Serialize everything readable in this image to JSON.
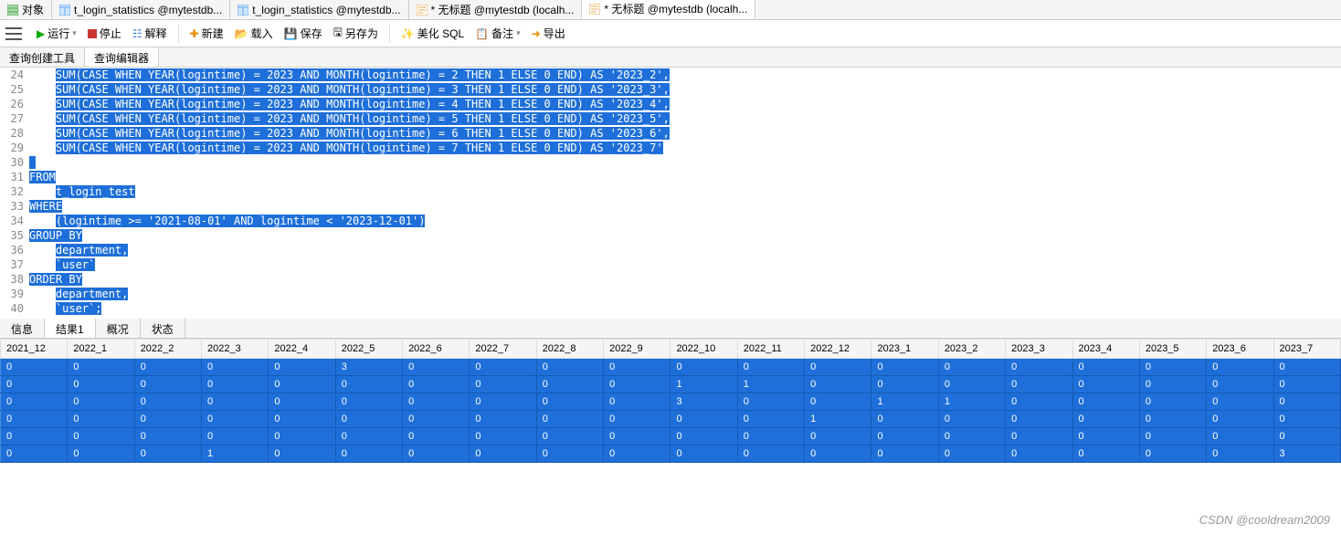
{
  "tabs": [
    {
      "label": "对象"
    },
    {
      "label": "t_login_statistics @mytestdb..."
    },
    {
      "label": "t_login_statistics @mytestdb..."
    },
    {
      "label": "* 无标题 @mytestdb (localh..."
    },
    {
      "label": "* 无标题 @mytestdb (localh..."
    }
  ],
  "toolbar": {
    "run": "运行",
    "stop": "停止",
    "explain": "解释",
    "new": "新建",
    "load": "载入",
    "save": "保存",
    "saveas": "另存为",
    "beautify": "美化 SQL",
    "comment": "备注",
    "export": "导出"
  },
  "secondaryTabs": [
    "查询创建工具",
    "查询编辑器"
  ],
  "code": {
    "startLine": 24,
    "lines": [
      "    SUM(CASE WHEN YEAR(logintime) = 2023 AND MONTH(logintime) = 2 THEN 1 ELSE 0 END) AS '2023_2',",
      "    SUM(CASE WHEN YEAR(logintime) = 2023 AND MONTH(logintime) = 3 THEN 1 ELSE 0 END) AS '2023_3',",
      "    SUM(CASE WHEN YEAR(logintime) = 2023 AND MONTH(logintime) = 4 THEN 1 ELSE 0 END) AS '2023_4',",
      "    SUM(CASE WHEN YEAR(logintime) = 2023 AND MONTH(logintime) = 5 THEN 1 ELSE 0 END) AS '2023_5',",
      "    SUM(CASE WHEN YEAR(logintime) = 2023 AND MONTH(logintime) = 6 THEN 1 ELSE 0 END) AS '2023_6',",
      "    SUM(CASE WHEN YEAR(logintime) = 2023 AND MONTH(logintime) = 7 THEN 1 ELSE 0 END) AS '2023_7'",
      "",
      "FROM",
      "    t_login_test",
      "WHERE",
      "    (logintime >= '2021-08-01' AND logintime < '2023-12-01')",
      "GROUP BY",
      "    department,",
      "    `user`",
      "ORDER BY",
      "    department,",
      "    `user`;"
    ]
  },
  "resultTabs": [
    "信息",
    "结果1",
    "概况",
    "状态"
  ],
  "grid": {
    "columns": [
      "2021_12",
      "2022_1",
      "2022_2",
      "2022_3",
      "2022_4",
      "2022_5",
      "2022_6",
      "2022_7",
      "2022_8",
      "2022_9",
      "2022_10",
      "2022_11",
      "2022_12",
      "2023_1",
      "2023_2",
      "2023_3",
      "2023_4",
      "2023_5",
      "2023_6",
      "2023_7"
    ],
    "rows": [
      [
        0,
        0,
        0,
        0,
        0,
        3,
        0,
        0,
        0,
        0,
        0,
        0,
        0,
        0,
        0,
        0,
        0,
        0,
        0,
        0
      ],
      [
        0,
        0,
        0,
        0,
        0,
        0,
        0,
        0,
        0,
        0,
        1,
        1,
        0,
        0,
        0,
        0,
        0,
        0,
        0,
        0
      ],
      [
        0,
        0,
        0,
        0,
        0,
        0,
        0,
        0,
        0,
        0,
        3,
        0,
        0,
        1,
        1,
        0,
        0,
        0,
        0,
        0
      ],
      [
        0,
        0,
        0,
        0,
        0,
        0,
        0,
        0,
        0,
        0,
        0,
        0,
        1,
        0,
        0,
        0,
        0,
        0,
        0,
        0
      ],
      [
        0,
        0,
        0,
        0,
        0,
        0,
        0,
        0,
        0,
        0,
        0,
        0,
        0,
        0,
        0,
        0,
        0,
        0,
        0,
        0
      ],
      [
        0,
        0,
        0,
        1,
        0,
        0,
        0,
        0,
        0,
        0,
        0,
        0,
        0,
        0,
        0,
        0,
        0,
        0,
        0,
        3
      ]
    ]
  },
  "watermark": "CSDN @cooldream2009"
}
